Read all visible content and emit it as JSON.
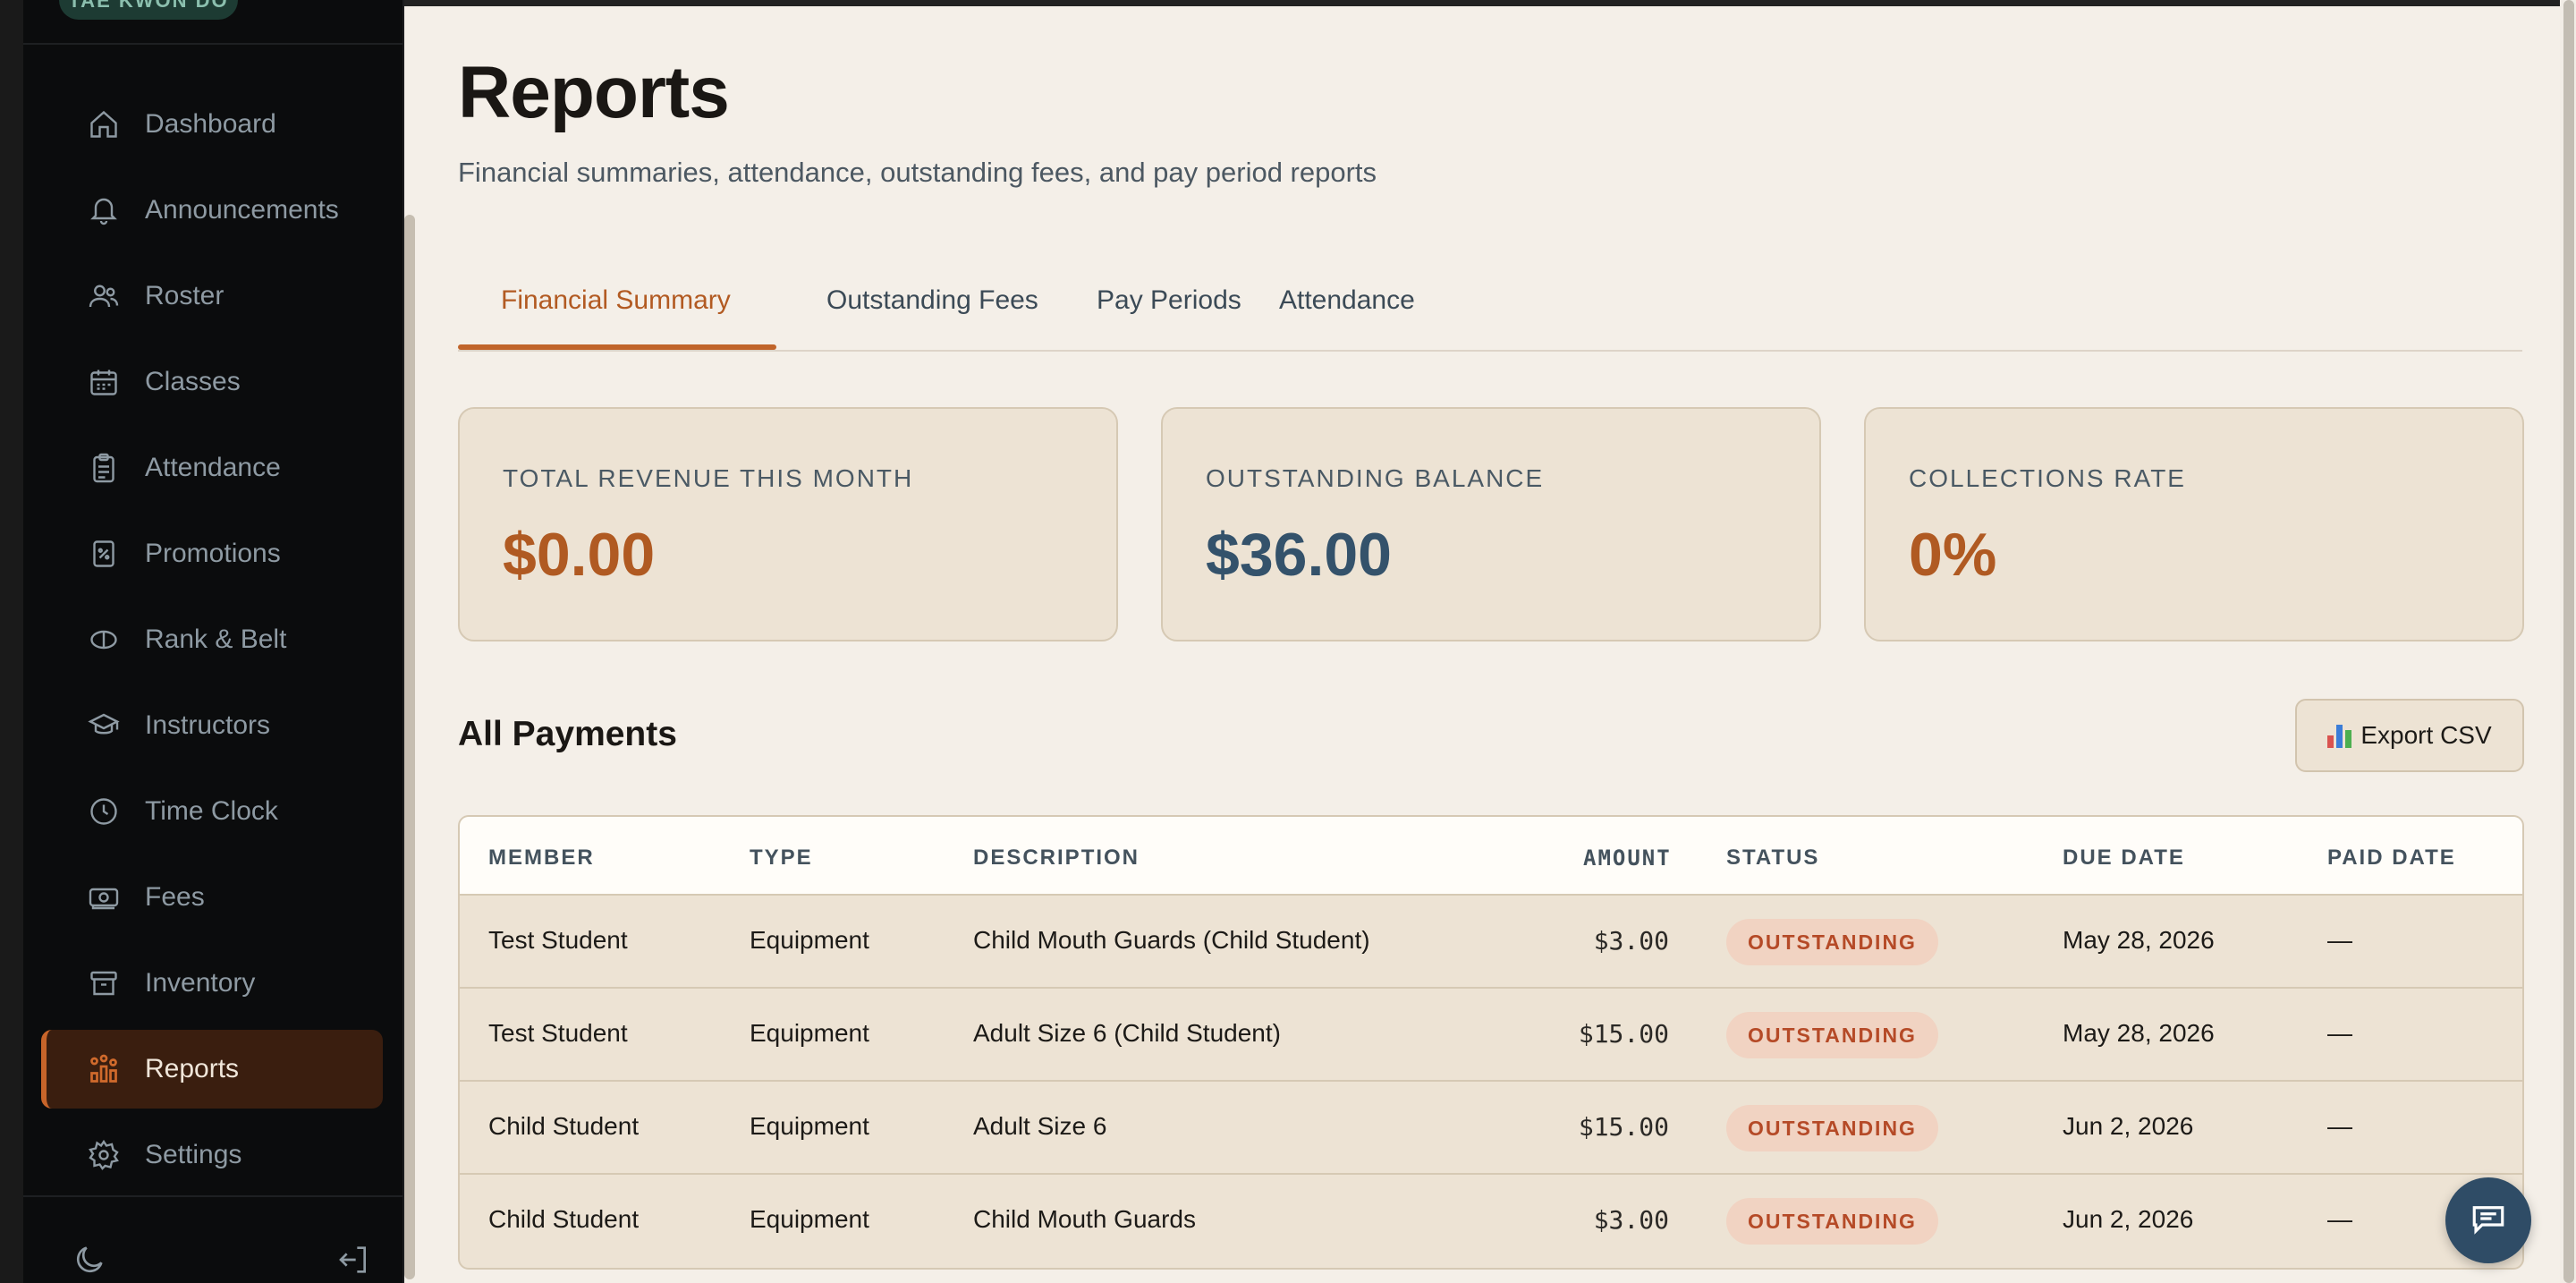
{
  "brand": {
    "badge": "TAE KWON DO"
  },
  "sidebar": {
    "items": [
      {
        "label": "Dashboard",
        "icon": "home-icon",
        "active": false
      },
      {
        "label": "Announcements",
        "icon": "bell-icon",
        "active": false
      },
      {
        "label": "Roster",
        "icon": "users-icon",
        "active": false
      },
      {
        "label": "Classes",
        "icon": "calendar-icon",
        "active": false
      },
      {
        "label": "Attendance",
        "icon": "clipboard-icon",
        "active": false
      },
      {
        "label": "Promotions",
        "icon": "percent-doc-icon",
        "active": false
      },
      {
        "label": "Rank & Belt",
        "icon": "belt-icon",
        "active": false
      },
      {
        "label": "Instructors",
        "icon": "graduation-cap-icon",
        "active": false
      },
      {
        "label": "Time Clock",
        "icon": "clock-icon",
        "active": false
      },
      {
        "label": "Fees",
        "icon": "money-icon",
        "active": false
      },
      {
        "label": "Inventory",
        "icon": "archive-box-icon",
        "active": false
      },
      {
        "label": "Reports",
        "icon": "chart-icon",
        "active": true
      },
      {
        "label": "Settings",
        "icon": "gear-icon",
        "active": false
      }
    ],
    "footer": {
      "theme_icon": "moon-icon",
      "logout_icon": "logout-icon"
    }
  },
  "page": {
    "title": "Reports",
    "subtitle": "Financial summaries, attendance, outstanding fees, and pay period reports"
  },
  "tabs": [
    {
      "label": "Financial Summary",
      "active": true
    },
    {
      "label": "Outstanding Fees",
      "active": false
    },
    {
      "label": "Pay Periods",
      "active": false
    },
    {
      "label": "Attendance",
      "active": false
    }
  ],
  "cards": [
    {
      "label": "TOTAL REVENUE THIS MONTH",
      "value": "$0.00",
      "color": "#b05a22"
    },
    {
      "label": "OUTSTANDING BALANCE",
      "value": "$36.00",
      "color": "#34526b"
    },
    {
      "label": "COLLECTIONS RATE",
      "value": "0%",
      "color": "#b05a22"
    }
  ],
  "payments": {
    "title": "All Payments",
    "export_label": "Export CSV",
    "columns": [
      "MEMBER",
      "TYPE",
      "DESCRIPTION",
      "AMOUNT",
      "STATUS",
      "DUE DATE",
      "PAID DATE"
    ],
    "rows": [
      {
        "member": "Test Student",
        "type": "Equipment",
        "description": "Child Mouth Guards (Child Student)",
        "amount": "$3.00",
        "status": "OUTSTANDING",
        "due": "May 28, 2026",
        "paid": "—"
      },
      {
        "member": "Test Student",
        "type": "Equipment",
        "description": "Adult Size 6 (Child Student)",
        "amount": "$15.00",
        "status": "OUTSTANDING",
        "due": "May 28, 2026",
        "paid": "—"
      },
      {
        "member": "Child Student",
        "type": "Equipment",
        "description": "Adult Size 6",
        "amount": "$15.00",
        "status": "OUTSTANDING",
        "due": "Jun 2, 2026",
        "paid": "—"
      },
      {
        "member": "Child Student",
        "type": "Equipment",
        "description": "Child Mouth Guards",
        "amount": "$3.00",
        "status": "OUTSTANDING",
        "due": "Jun 2, 2026",
        "paid": "—"
      }
    ]
  },
  "chat": {
    "icon": "chat-icon"
  }
}
